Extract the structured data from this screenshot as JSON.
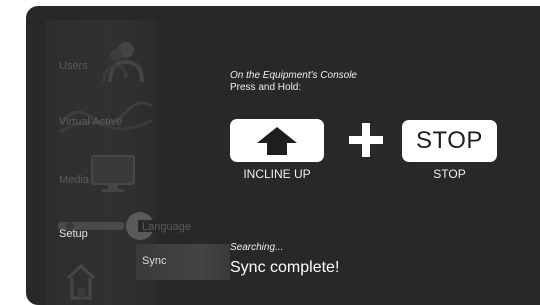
{
  "menu": {
    "items": [
      {
        "label": "Users",
        "icon": "users-icon"
      },
      {
        "label": "Virtual Active",
        "icon": "virtual-active-icon"
      },
      {
        "label": "Media",
        "icon": "monitor-icon"
      },
      {
        "label": "Setup",
        "icon": "wrench-icon",
        "active": true
      },
      {
        "label": "",
        "icon": "home-icon"
      }
    ]
  },
  "submenu": {
    "items": [
      {
        "label": "Language"
      },
      {
        "label": "Sync",
        "active": true
      }
    ]
  },
  "content": {
    "instruction_line1": "On the Equipment's Console",
    "instruction_line2": "Press and Hold:",
    "incline_caption": "INCLINE UP",
    "stop_key_text": "STOP",
    "stop_caption": "STOP",
    "searching": "Searching...",
    "status": "Sync complete!"
  },
  "colors": {
    "screen_bg": "#282828",
    "menu_text_dim": "#5a5a5a",
    "key_bg": "#ffffff",
    "text": "#f0f0f0"
  }
}
